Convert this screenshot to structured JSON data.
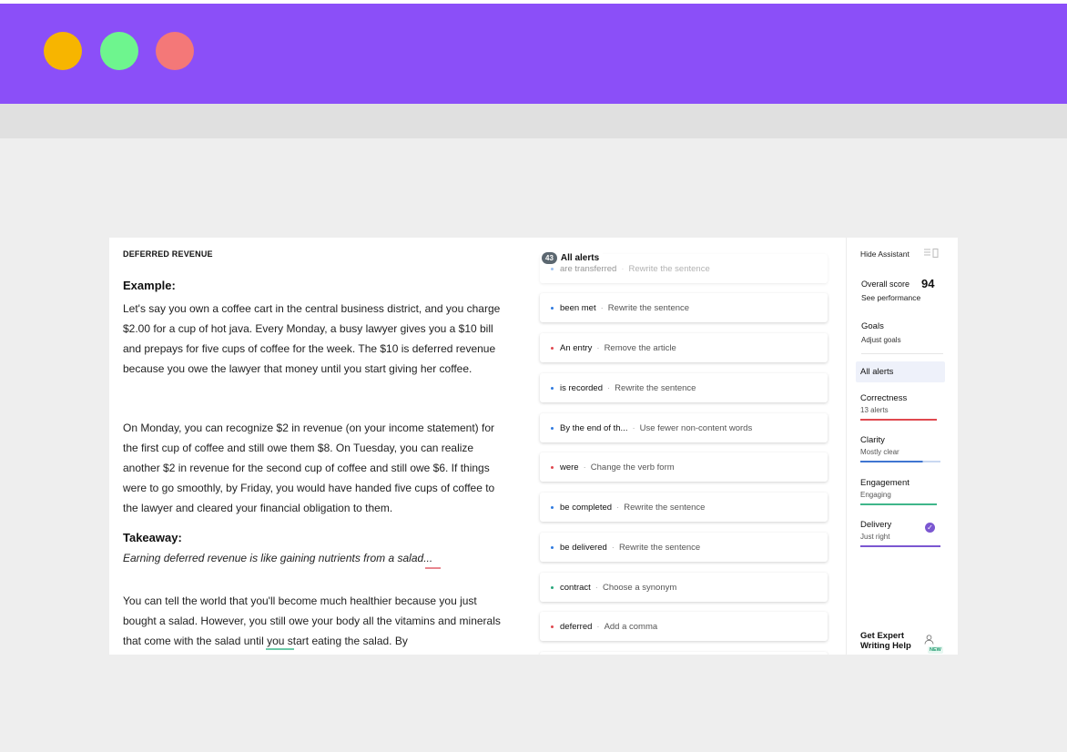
{
  "window": {
    "traffic_lights": [
      {
        "name": "minimize",
        "color": "#f7b500"
      },
      {
        "name": "maximize",
        "color": "#6ef58e"
      },
      {
        "name": "close",
        "color": "#f47878"
      }
    ],
    "titlebar_color": "#8b4ff8"
  },
  "document": {
    "title": "DEFERRED REVENUE",
    "example_heading": "Example:",
    "paragraph1": "Let's say you own a coffee cart in the central business district, and you charge $2.00 for a cup of hot java. Every Monday, a busy lawyer gives you a $10 bill and prepays for five cups of coffee for the week. The $10 is deferred revenue because you owe the lawyer that money until you start giving her coffee.",
    "paragraph2": "On Monday, you can recognize $2 in revenue (on your income statement) for the first cup of coffee and still owe them $8. On Tuesday, you can realize another $2 in revenue for the second cup of coffee and still owe $6. If things were to go smoothly, by Friday, you would have handed five cups of coffee to the lawyer and cleared your financial obligation to them.",
    "takeaway_heading": "Takeaway:",
    "takeaway_text": "Earning deferred revenue is like gaining nutrients from a salad...",
    "paragraph3": "You can tell the world that you'll become much healthier because you just bought a salad. However, you still owe your body all the vitamins and minerals that come with the salad until you start eating the salad. By"
  },
  "alerts": {
    "count": "43",
    "label": "All alerts",
    "items": [
      {
        "word": "are transferred",
        "action": "Rewrite the sentence",
        "dot": "blue"
      },
      {
        "word": "been met",
        "action": "Rewrite the sentence",
        "dot": "blue"
      },
      {
        "word": "An entry",
        "action": "Remove the article",
        "dot": "red"
      },
      {
        "word": "is recorded",
        "action": "Rewrite the sentence",
        "dot": "blue"
      },
      {
        "word": "By the end of th...",
        "action": "Use fewer non-content words",
        "dot": "blue"
      },
      {
        "word": "were",
        "action": "Change the verb form",
        "dot": "red"
      },
      {
        "word": "be completed",
        "action": "Rewrite the sentence",
        "dot": "blue"
      },
      {
        "word": "be delivered",
        "action": "Rewrite the sentence",
        "dot": "blue"
      },
      {
        "word": "contract",
        "action": "Choose a synonym",
        "dot": "green"
      },
      {
        "word": "deferred",
        "action": "Add a comma",
        "dot": "red"
      }
    ]
  },
  "sidebar": {
    "hide_assistant": "Hide Assistant",
    "overall_score_label": "Overall score",
    "overall_score_value": "94",
    "see_performance": "See performance",
    "goals_label": "Goals",
    "adjust_goals": "Adjust goals",
    "all_alerts": "All alerts",
    "categories": [
      {
        "name": "Correctness",
        "sub": "13 alerts",
        "color": "#e0484f"
      },
      {
        "name": "Clarity",
        "sub": "Mostly clear",
        "color": "#3f76d1"
      },
      {
        "name": "Engagement",
        "sub": "Engaging",
        "color": "#3fb68a"
      },
      {
        "name": "Delivery",
        "sub": "Just right",
        "color": "#7b57d1"
      }
    ],
    "expert_help": "Get Expert Writing Help",
    "new_badge": "NEW"
  }
}
